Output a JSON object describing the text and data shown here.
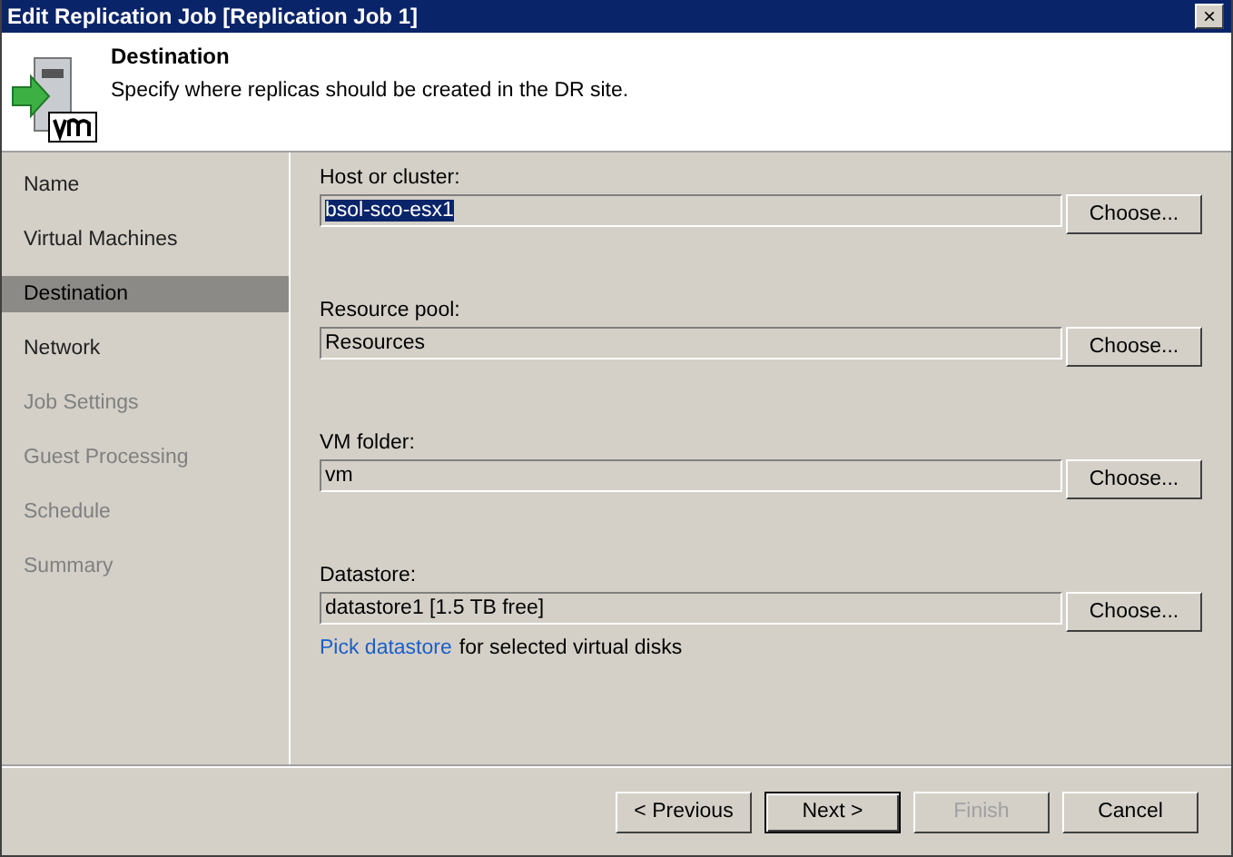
{
  "window": {
    "title": "Edit Replication Job [Replication Job 1]",
    "close": "×"
  },
  "header": {
    "title": "Destination",
    "subtitle": "Specify where replicas should be created in the DR site."
  },
  "sidebar": {
    "items": [
      {
        "label": "Name",
        "selected": false,
        "disabled": false
      },
      {
        "label": "Virtual Machines",
        "selected": false,
        "disabled": false
      },
      {
        "label": "Destination",
        "selected": true,
        "disabled": false
      },
      {
        "label": "Network",
        "selected": false,
        "disabled": false
      },
      {
        "label": "Job Settings",
        "selected": false,
        "disabled": true
      },
      {
        "label": "Guest Processing",
        "selected": false,
        "disabled": true
      },
      {
        "label": "Schedule",
        "selected": false,
        "disabled": true
      },
      {
        "label": "Summary",
        "selected": false,
        "disabled": true
      }
    ]
  },
  "fields": [
    {
      "label": "Host or cluster:",
      "value": "bsol-sco-esx1",
      "selected": true,
      "button": "Choose..."
    },
    {
      "label": "Resource pool:",
      "value": "Resources",
      "selected": false,
      "button": "Choose..."
    },
    {
      "label": "VM folder:",
      "value": "vm",
      "selected": false,
      "button": "Choose..."
    },
    {
      "label": "Datastore:",
      "value": "datastore1 [1.5 TB free]",
      "selected": false,
      "button": "Choose...",
      "link": "Pick datastore",
      "note": "for selected virtual disks"
    }
  ],
  "buttons": [
    {
      "label": "< Previous",
      "kind": "normal",
      "disabled": false
    },
    {
      "label": "Next >",
      "kind": "default",
      "disabled": false
    },
    {
      "label": "Finish",
      "kind": "normal",
      "disabled": true
    },
    {
      "label": "Cancel",
      "kind": "normal",
      "disabled": false
    }
  ]
}
